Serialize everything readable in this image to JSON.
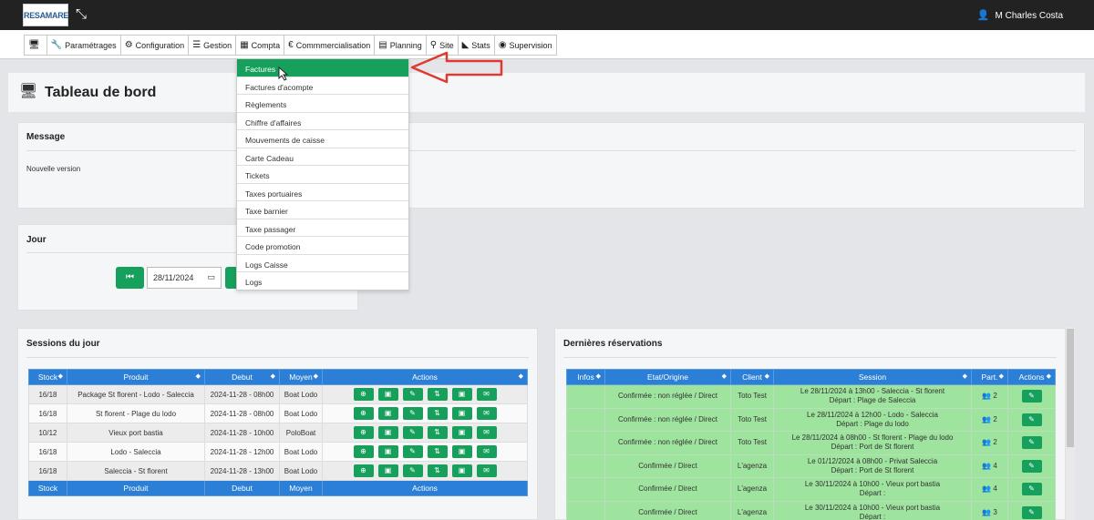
{
  "app": {
    "logo_text": "RESAMARE",
    "user_name": "M Charles Costa"
  },
  "nav": {
    "items": [
      {
        "label": "",
        "icon": "desktop-icon"
      },
      {
        "label": "Paramétrages",
        "icon": "wrench-icon"
      },
      {
        "label": "Configuration",
        "icon": "gears-icon"
      },
      {
        "label": "Gestion",
        "icon": "list-icon"
      },
      {
        "label": "Compta",
        "icon": "calculator-icon"
      },
      {
        "label": "Commmercialisation",
        "icon": "euro-icon"
      },
      {
        "label": "Planning",
        "icon": "calendar-icon"
      },
      {
        "label": "Site",
        "icon": "sitemap-icon"
      },
      {
        "label": "Stats",
        "icon": "chart-icon"
      },
      {
        "label": "Supervision",
        "icon": "eye-icon"
      }
    ]
  },
  "compta_menu": {
    "items": [
      "Factures",
      "Factures d'acompte",
      "Règlements",
      "Chiffre d'affaires",
      "Mouvements de caisse",
      "Carte Cadeau",
      "Tickets",
      "Taxes portuaires",
      "Taxe barnier",
      "Taxe passager",
      "Code promotion",
      "Logs Caisse",
      "Logs"
    ],
    "active": "Factures"
  },
  "page": {
    "title": "Tableau de bord"
  },
  "message": {
    "title": "Message",
    "text": "Nouvelle version"
  },
  "jour": {
    "title": "Jour",
    "date_value": "28/11/2024"
  },
  "sessions": {
    "title": "Sessions du jour",
    "columns": [
      "Stock",
      "Produit",
      "Debut",
      "Moyen",
      "Actions"
    ],
    "footer": [
      "Stock",
      "Produit",
      "Debut",
      "Moyen",
      "Actions"
    ],
    "rows": [
      {
        "stock": "16/18",
        "produit": "Package St florent - Lodo - Saleccia",
        "debut": "2024-11-28 - 08h00",
        "moyen": "Boat Lodo"
      },
      {
        "stock": "16/18",
        "produit": "St florent - Plage du lodo",
        "debut": "2024-11-28 - 08h00",
        "moyen": "Boat Lodo"
      },
      {
        "stock": "10/12",
        "produit": "Vieux port bastia",
        "debut": "2024-11-28 - 10h00",
        "moyen": "PoloBoat"
      },
      {
        "stock": "16/18",
        "produit": "Lodo - Saleccia",
        "debut": "2024-11-28 - 12h00",
        "moyen": "Boat Lodo"
      },
      {
        "stock": "16/18",
        "produit": "Saleccia - St florent",
        "debut": "2024-11-28 - 13h00",
        "moyen": "Boat Lodo"
      }
    ]
  },
  "reservations": {
    "title": "Dernières réservations",
    "columns": [
      "Infos",
      "Etat/Origine",
      "Client",
      "Session",
      "Part.",
      "Actions"
    ],
    "rows": [
      {
        "etat": "Confirmée : non réglée / Direct",
        "client": "Toto Test",
        "session_line1": "Le 28/11/2024 à 13h00 - Saleccia - St florent",
        "session_line2": "Départ : Plage de Saleccia",
        "part": "2"
      },
      {
        "etat": "Confirmée : non réglée / Direct",
        "client": "Toto Test",
        "session_line1": "Le 28/11/2024 à 12h00 - Lodo - Saleccia",
        "session_line2": "Départ : Plage du lodo",
        "part": "2"
      },
      {
        "etat": "Confirmée : non réglée / Direct",
        "client": "Toto Test",
        "session_line1": "Le 28/11/2024 à 08h00 - St florent - Plage du lodo",
        "session_line2": "Départ : Port de St florent",
        "part": "2"
      },
      {
        "etat": "Confirmée / Direct",
        "client": "L'agenza",
        "session_line1": "Le 01/12/2024 à 08h00 - Privat Saleccia",
        "session_line2": "Départ : Port de St florent",
        "part": "4"
      },
      {
        "etat": "Confirmée / Direct",
        "client": "L'agenza",
        "session_line1": "Le 30/11/2024 à 10h00 - Vieux port bastia",
        "session_line2": "Départ :",
        "part": "4"
      },
      {
        "etat": "Confirmée / Direct",
        "client": "L'agenza",
        "session_line1": "Le 30/11/2024 à 10h00 - Vieux port bastia",
        "session_line2": "Départ :",
        "part": "3"
      }
    ]
  },
  "colors": {
    "accent_green": "#16a05c",
    "header_blue": "#2b7fd6",
    "row_green": "#9ee39e",
    "arrow_red": "#e03a2f"
  }
}
